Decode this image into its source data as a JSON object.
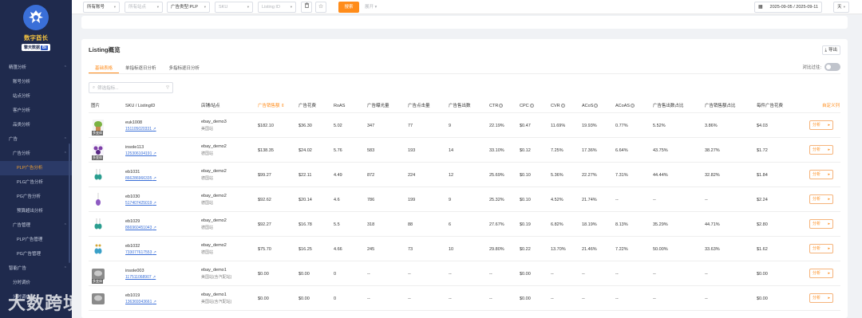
{
  "sidebar": {
    "brand": "数字酋长",
    "brand_sub": "擎天数据",
    "brand_sub_bi": "BI",
    "items": [
      {
        "label": "精匯分析",
        "level": "group",
        "chev": "^"
      },
      {
        "label": "账号分析",
        "level": "l1"
      },
      {
        "label": "站点分析",
        "level": "l1"
      },
      {
        "label": "客户分析",
        "level": "l1"
      },
      {
        "label": "品类分析",
        "level": "l1"
      },
      {
        "label": "广告",
        "level": "group",
        "chev": "^"
      },
      {
        "label": "广告分析",
        "level": "l1",
        "chev": "^"
      },
      {
        "label": "PLP广告分析",
        "level": "l2",
        "active": true
      },
      {
        "label": "PLG广告分析",
        "level": "l2"
      },
      {
        "label": "PG广告分析",
        "level": "l2"
      },
      {
        "label": "预算超出分析",
        "level": "l2"
      },
      {
        "label": "广告管理",
        "level": "l1",
        "chev": "^"
      },
      {
        "label": "PLP广告管理",
        "level": "l2"
      },
      {
        "label": "PG广告管理",
        "level": "l2"
      },
      {
        "label": "智能广告",
        "level": "group",
        "chev": "^"
      },
      {
        "label": "分时调价",
        "level": "l1"
      },
      {
        "label": "分时调价",
        "level": "l1"
      }
    ]
  },
  "watermark": "大数跨境",
  "filterbar": {
    "account": "所有账号",
    "site": "所有站点",
    "ad_type": "广告类型:PLP",
    "sku_placeholder": "SKU",
    "listing_placeholder": "Listing ID",
    "search_label": "搜索",
    "expand_label": "展开",
    "date_range": "2025-09-05 / 2025-09-11",
    "compare_select": "天"
  },
  "card": {
    "title": "Listing概览",
    "export_label": "导出",
    "tabs": [
      "基础表格",
      "单指标逐日分析",
      "多指标逐日分析"
    ],
    "compare_label": "对比过往:",
    "filter_placeholder": "筛选指标..."
  },
  "table": {
    "headers": [
      "图片",
      "SKU / ListingID",
      "店铺/站点",
      "广告销售额",
      "广告花费",
      "RoAS",
      "广告曝光量",
      "广告点击量",
      "广告售出数",
      "CTR",
      "CPC",
      "CVR",
      "ACoS",
      "ACoAS",
      "广告售出数占比",
      "广告销售额占比",
      "每件广告花费",
      "自定义列"
    ],
    "action_label": "分析",
    "rows": [
      {
        "sku": "euk1008",
        "listing": "151105020331",
        "shop": "ebay_demo3",
        "site": "美国站",
        "sales": "$182.10",
        "spend": "$36.30",
        "roas": "5.02",
        "impr": "347",
        "clicks": "77",
        "sold": "9",
        "ctr": "22.19%",
        "cpc": "$0.47",
        "cvr": "11.69%",
        "acos": "19.93%",
        "acoas": "0.77%",
        "sold_share": "5.52%",
        "sales_share": "3.86%",
        "cost_per": "$4.03",
        "thumb": "plant",
        "thumb_label": "多变体"
      },
      {
        "sku": "insole113",
        "listing": "125306104191",
        "shop": "ebay_demo2",
        "site": "德国站",
        "sales": "$138.35",
        "spend": "$24.02",
        "roas": "5.76",
        "impr": "583",
        "clicks": "193",
        "sold": "14",
        "ctr": "33.10%",
        "cpc": "$0.12",
        "cvr": "7.25%",
        "acos": "17.36%",
        "acoas": "6.64%",
        "sold_share": "43.75%",
        "sales_share": "38.27%",
        "cost_per": "$1.72",
        "thumb": "jewel",
        "thumb_label": "多变体"
      },
      {
        "sku": "eb1031",
        "listing": "866286966335",
        "shop": "ebay_demo2",
        "site": "德国站",
        "sales": "$99.27",
        "spend": "$22.11",
        "roas": "4.49",
        "impr": "872",
        "clicks": "224",
        "sold": "12",
        "ctr": "25.69%",
        "cpc": "$0.10",
        "cvr": "5.36%",
        "acos": "22.27%",
        "acoas": "7.31%",
        "sold_share": "44.44%",
        "sales_share": "32.82%",
        "cost_per": "$1.84",
        "thumb": "earring",
        "thumb_label": ""
      },
      {
        "sku": "eb1030",
        "listing": "517407425019",
        "shop": "ebay_demo2",
        "site": "德国站",
        "sales": "$92.62",
        "spend": "$20.14",
        "roas": "4.6",
        "impr": "786",
        "clicks": "199",
        "sold": "9",
        "ctr": "25.32%",
        "cpc": "$0.10",
        "cvr": "4.52%",
        "acos": "21.74%",
        "acoas": "--",
        "sold_share": "--",
        "sales_share": "--",
        "cost_per": "$2.24",
        "thumb": "pendant",
        "thumb_label": ""
      },
      {
        "sku": "eb1029",
        "listing": "866960451043",
        "shop": "ebay_demo2",
        "site": "德国站",
        "sales": "$92.27",
        "spend": "$16.78",
        "roas": "5.5",
        "impr": "318",
        "clicks": "88",
        "sold": "6",
        "ctr": "27.67%",
        "cpc": "$0.19",
        "cvr": "6.82%",
        "acos": "18.19%",
        "acoas": "8.13%",
        "sold_share": "35.29%",
        "sales_share": "44.71%",
        "cost_per": "$2.80",
        "thumb": "earring",
        "thumb_label": ""
      },
      {
        "sku": "eb1032",
        "listing": "733077617553",
        "shop": "ebay_demo2",
        "site": "德国站",
        "sales": "$75.70",
        "spend": "$16.25",
        "roas": "4.66",
        "impr": "245",
        "clicks": "73",
        "sold": "10",
        "ctr": "29.80%",
        "cpc": "$0.22",
        "cvr": "13.70%",
        "acos": "21.46%",
        "acoas": "7.22%",
        "sold_share": "50.00%",
        "sales_share": "33.63%",
        "cost_per": "$1.62",
        "thumb": "earring-gold",
        "thumb_label": ""
      },
      {
        "sku": "insole003",
        "listing": "117511068907",
        "shop": "ebay_demo1",
        "site": "美国站(含汽配站)",
        "sales": "$0.00",
        "spend": "$0.00",
        "roas": "0",
        "impr": "--",
        "clicks": "--",
        "sold": "--",
        "ctr": "--",
        "cpc": "$0.00",
        "cvr": "--",
        "acos": "--",
        "acoas": "--",
        "sold_share": "--",
        "sales_share": "--",
        "cost_per": "$0.00",
        "thumb": "gray",
        "thumb_label": "多变体"
      },
      {
        "sku": "eb1019",
        "listing": "136369343661",
        "shop": "ebay_demo1",
        "site": "美国站(含汽配站)",
        "sales": "$0.00",
        "spend": "$0.00",
        "roas": "0",
        "impr": "--",
        "clicks": "--",
        "sold": "--",
        "ctr": "--",
        "cpc": "$0.00",
        "cvr": "--",
        "acos": "--",
        "acoas": "--",
        "sold_share": "--",
        "sales_share": "--",
        "cost_per": "$0.00",
        "thumb": "gray",
        "thumb_label": ""
      }
    ]
  },
  "colors": {
    "accent": "#ff8c1a",
    "sidebar": "#1f2a4d",
    "link": "#3a6fd8"
  }
}
